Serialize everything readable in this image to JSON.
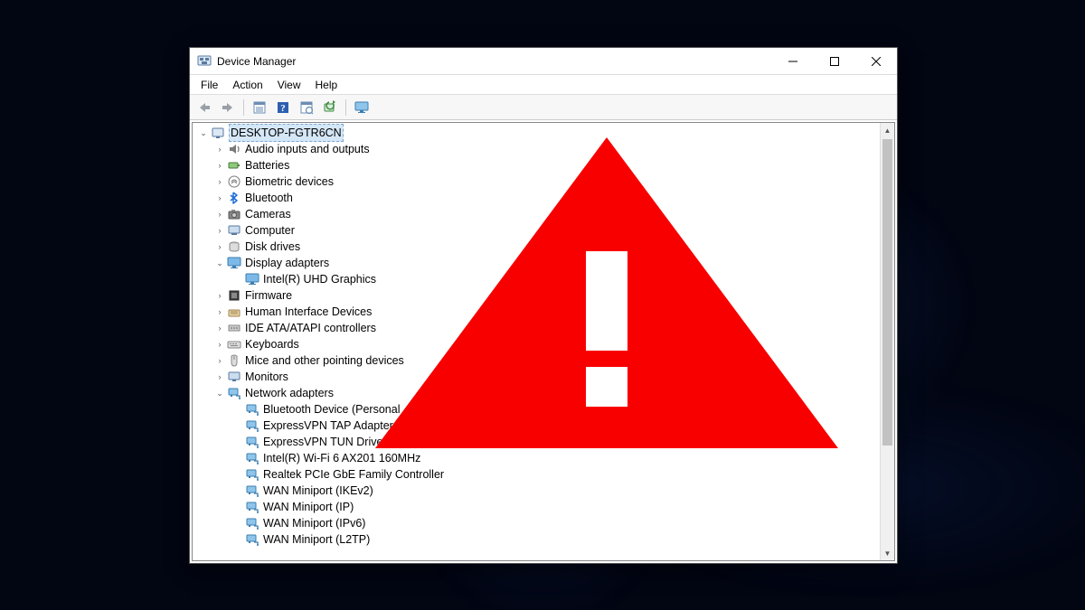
{
  "window": {
    "title": "Device Manager"
  },
  "menu": {
    "items": [
      "File",
      "Action",
      "View",
      "Help"
    ]
  },
  "toolbar": {
    "buttons": [
      "back",
      "forward",
      "properties",
      "help",
      "scan",
      "update",
      "monitor"
    ]
  },
  "tree": {
    "root": "DESKTOP-FGTR6CN",
    "nodes": [
      {
        "label": "Audio inputs and outputs",
        "expanded": false,
        "icon": "audio",
        "children": []
      },
      {
        "label": "Batteries",
        "expanded": false,
        "icon": "battery",
        "children": []
      },
      {
        "label": "Biometric devices",
        "expanded": false,
        "icon": "biometric",
        "children": []
      },
      {
        "label": "Bluetooth",
        "expanded": false,
        "icon": "bluetooth",
        "children": []
      },
      {
        "label": "Cameras",
        "expanded": false,
        "icon": "camera",
        "children": []
      },
      {
        "label": "Computer",
        "expanded": false,
        "icon": "computer",
        "children": []
      },
      {
        "label": "Disk drives",
        "expanded": false,
        "icon": "disk",
        "children": []
      },
      {
        "label": "Display adapters",
        "expanded": true,
        "icon": "display",
        "children": [
          {
            "label": "Intel(R) UHD Graphics",
            "icon": "display"
          }
        ]
      },
      {
        "label": "Firmware",
        "expanded": false,
        "icon": "firmware",
        "children": []
      },
      {
        "label": "Human Interface Devices",
        "expanded": false,
        "icon": "hid",
        "children": []
      },
      {
        "label": "IDE ATA/ATAPI controllers",
        "expanded": false,
        "icon": "ide",
        "children": []
      },
      {
        "label": "Keyboards",
        "expanded": false,
        "icon": "keyboard",
        "children": []
      },
      {
        "label": "Mice and other pointing devices",
        "expanded": false,
        "icon": "mouse",
        "children": []
      },
      {
        "label": "Monitors",
        "expanded": false,
        "icon": "monitor",
        "children": []
      },
      {
        "label": "Network adapters",
        "expanded": true,
        "icon": "network",
        "children": [
          {
            "label": "Bluetooth Device (Personal",
            "icon": "network"
          },
          {
            "label": "ExpressVPN TAP Adapter",
            "icon": "network"
          },
          {
            "label": "ExpressVPN TUN Driver",
            "icon": "network"
          },
          {
            "label": "Intel(R) Wi-Fi 6 AX201 160MHz",
            "icon": "network"
          },
          {
            "label": "Realtek PCIe GbE Family Controller",
            "icon": "network"
          },
          {
            "label": "WAN Miniport (IKEv2)",
            "icon": "network"
          },
          {
            "label": "WAN Miniport (IP)",
            "icon": "network"
          },
          {
            "label": "WAN Miniport (IPv6)",
            "icon": "network"
          },
          {
            "label": "WAN Miniport (L2TP)",
            "icon": "network"
          }
        ]
      }
    ]
  },
  "overlay": {
    "type": "warning-triangle",
    "color": "#f80000"
  }
}
